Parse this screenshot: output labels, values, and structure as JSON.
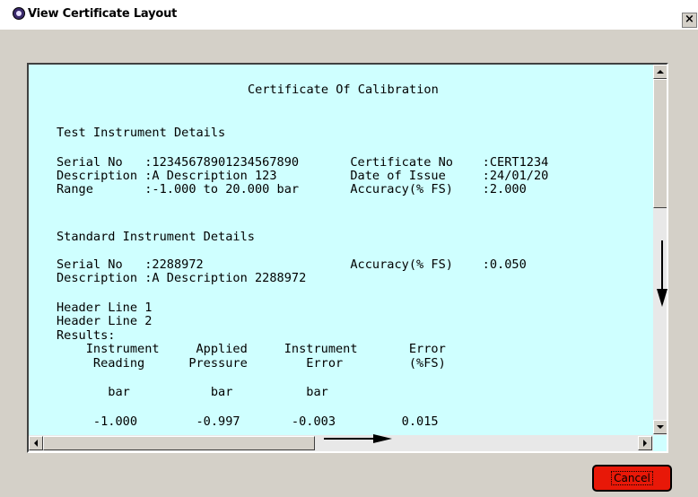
{
  "window": {
    "title": "View Certificate Layout",
    "close_label": "×"
  },
  "certificate": {
    "title": "Certificate Of Calibration",
    "test_heading": "Test Instrument Details",
    "test_lines": [
      "Serial No   :12345678901234567890       Certificate No    :CERT1234",
      "Description :A Description 123          Date of Issue     :24/01/20",
      "Range       :-1.000 to 20.000 bar       Accuracy(% FS)    :2.000"
    ],
    "standard_heading": "Standard Instrument Details",
    "standard_lines": [
      "Serial No   :2288972                    Accuracy(% FS)    :0.050",
      "Description :A Description 2288972"
    ],
    "header_lines": [
      "Header Line 1",
      "Header Line 2",
      "Results:"
    ],
    "results_header_1": "    Instrument     Applied     Instrument       Error",
    "results_header_2": "     Reading      Pressure        Error         (%FS)",
    "units_line": "       bar           bar          bar",
    "data_row": "     -1.000        -0.997       -0.003         0.015"
  },
  "buttons": {
    "cancel": "Cancel"
  }
}
